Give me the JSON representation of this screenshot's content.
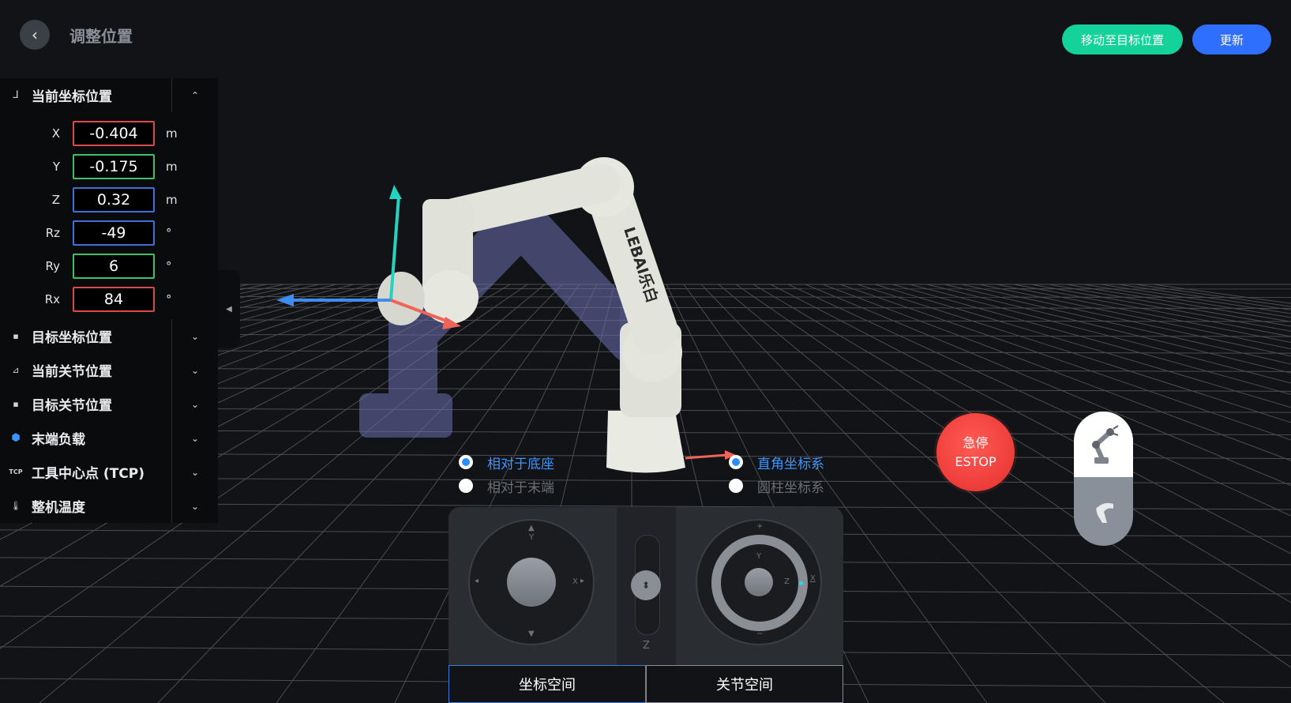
{
  "header": {
    "title": "调整位置",
    "move_to_target_label": "移动至目标位置",
    "update_label": "更新"
  },
  "panel": {
    "current_coords": {
      "title": "当前坐标位置",
      "rows": [
        {
          "label": "X",
          "value": "-0.404",
          "unit": "m",
          "color": "#d94b4b"
        },
        {
          "label": "Y",
          "value": "-0.175",
          "unit": "m",
          "color": "#3fbf6a"
        },
        {
          "label": "Z",
          "value": "0.32",
          "unit": "m",
          "color": "#3f6fd9"
        },
        {
          "label": "Rz",
          "value": "-49",
          "unit": "°",
          "color": "#3f6fd9"
        },
        {
          "label": "Ry",
          "value": "6",
          "unit": "°",
          "color": "#3fbf6a"
        },
        {
          "label": "Rx",
          "value": "84",
          "unit": "°",
          "color": "#d94b4b"
        }
      ]
    },
    "sections": [
      {
        "title": "目标坐标位置",
        "icon": "save-icon"
      },
      {
        "title": "当前关节位置",
        "icon": "angle-icon"
      },
      {
        "title": "目标关节位置",
        "icon": "save-icon"
      },
      {
        "title": "末端负载",
        "icon": "payload-icon"
      },
      {
        "title": "工具中心点 (TCP)",
        "icon": "tcp-icon"
      },
      {
        "title": "整机温度",
        "icon": "thermometer-icon"
      }
    ],
    "tcp_icon_text": "TCP"
  },
  "reference": {
    "options": [
      {
        "label": "相对于底座",
        "selected": true
      },
      {
        "label": "相对于末端",
        "selected": false
      }
    ]
  },
  "coordinate_system": {
    "options": [
      {
        "label": "直角坐标系",
        "selected": true
      },
      {
        "label": "圆柱坐标系",
        "selected": false
      }
    ]
  },
  "joystick": {
    "left": {
      "up": "▲",
      "up_label": "Y",
      "right_label": "X",
      "right_arrow": "▸",
      "left_arrow": "◂",
      "down": "▼"
    },
    "z_label": "Z",
    "right": {
      "plus": "+",
      "minus": "−",
      "y_label": "Y",
      "z_label": "Z",
      "x_label": "X"
    }
  },
  "tabs": {
    "coordinate_space": "坐标空间",
    "joint_space": "关节空间"
  },
  "estop": {
    "line1": "急停",
    "line2": "ESTOP"
  },
  "robot_brand": "LEBAI乐白"
}
